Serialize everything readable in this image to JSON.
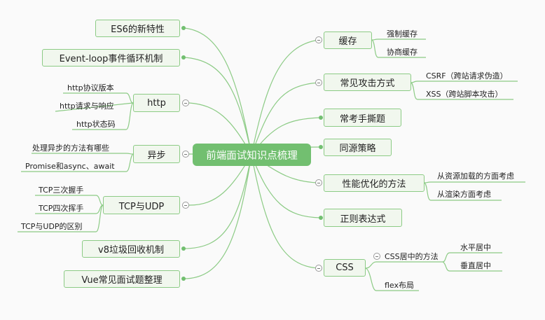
{
  "root": "前端面试知识点梳理",
  "right": [
    {
      "label": "缓存",
      "children": [
        "强制缓存",
        "协商缓存"
      ]
    },
    {
      "label": "常见攻击方式",
      "children": [
        "CSRF（跨站请求伪造）",
        "XSS（跨站脚本攻击）"
      ]
    },
    {
      "label": "常考手撕题"
    },
    {
      "label": "同源策略"
    },
    {
      "label": "性能优化的方法",
      "children": [
        "从资源加载的方面考虑",
        "从渲染方面考虑"
      ]
    },
    {
      "label": "正则表达式"
    },
    {
      "label": "CSS",
      "children": [
        {
          "label": "CSS居中的方法",
          "children": [
            "水平居中",
            "垂直居中"
          ]
        },
        {
          "label": "flex布局"
        }
      ]
    }
  ],
  "left": [
    {
      "label": "ES6的新特性"
    },
    {
      "label": "Event-loop事件循环机制"
    },
    {
      "label": "http",
      "children": [
        "http协议版本",
        "http请求与响应",
        "http状态码"
      ]
    },
    {
      "label": "异步",
      "children": [
        "处理异步的方法有哪些",
        "Promise和async、await"
      ]
    },
    {
      "label": "TCP与UDP",
      "children": [
        "TCP三次握手",
        "TCP四次挥手",
        "TCP与UDP的区别"
      ]
    },
    {
      "label": "v8垃圾回收机制"
    },
    {
      "label": "Vue常见面试题整理"
    }
  ]
}
